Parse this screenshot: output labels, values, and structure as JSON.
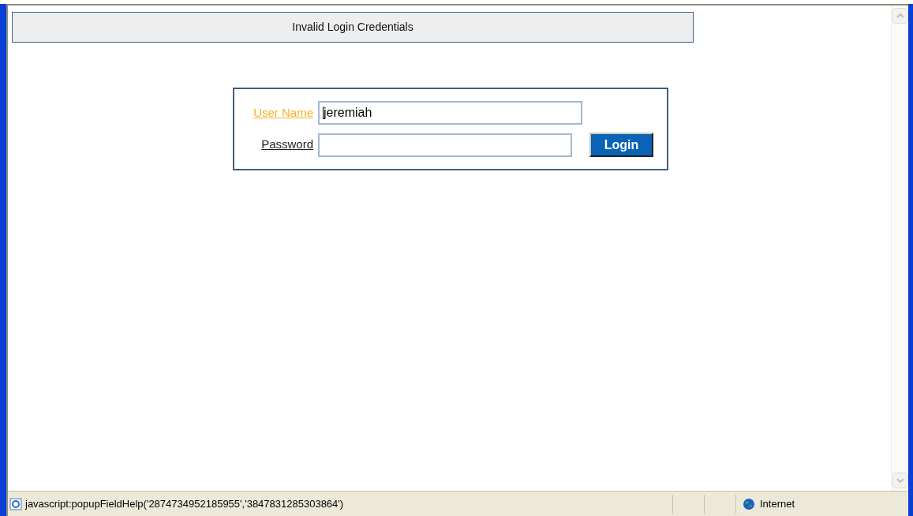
{
  "banner": {
    "message": "Invalid Login Credentials"
  },
  "login_form": {
    "fields": [
      {
        "label": "User Name",
        "label_hovered": true,
        "value": "jeremiah",
        "focused": true
      },
      {
        "label": "Password",
        "label_hovered": false,
        "focused": false
      }
    ],
    "button": "Login"
  },
  "status_bar": {
    "text": "javascript:popupFieldHelp('2874734952185955','3847831285303864')",
    "zone": "Internet"
  }
}
